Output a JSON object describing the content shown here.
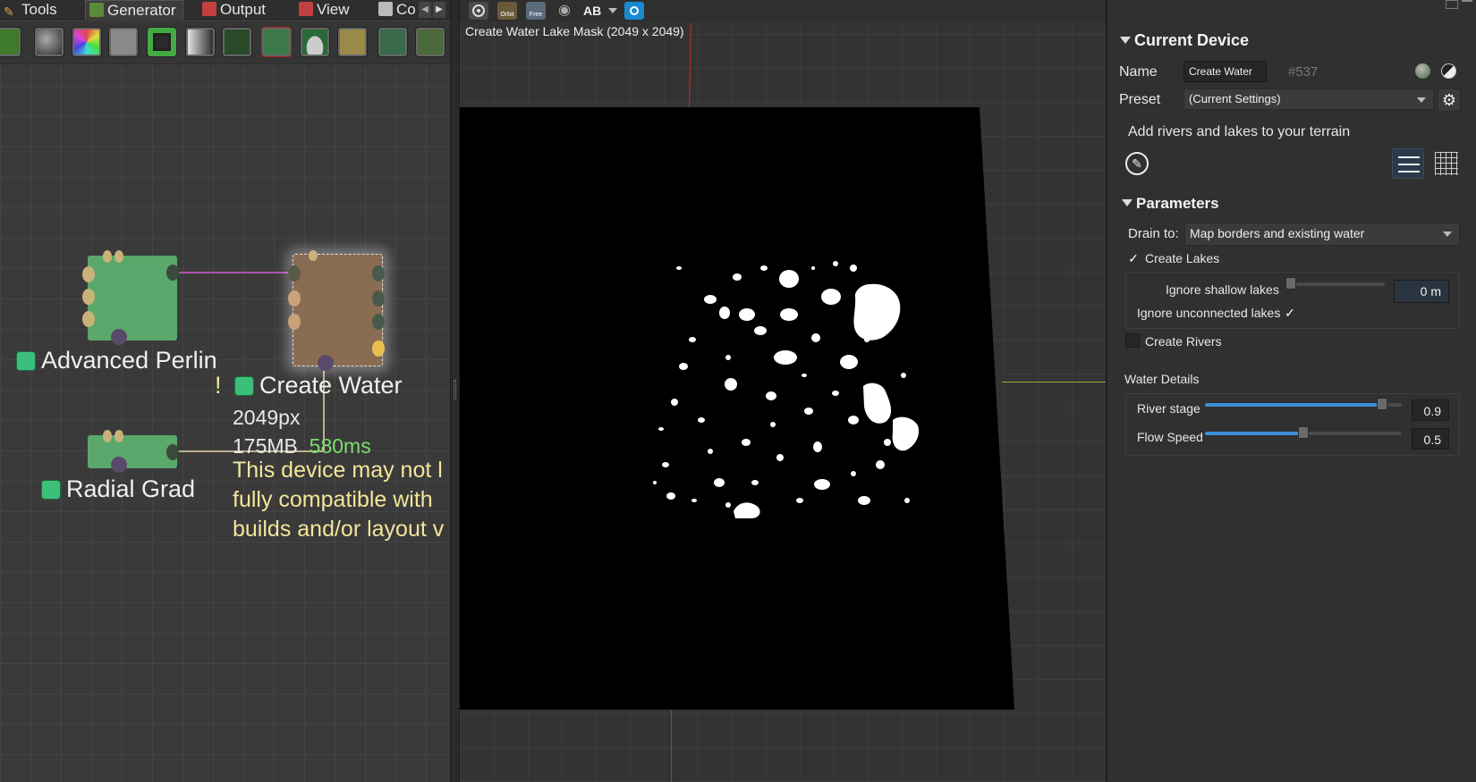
{
  "tabs": [
    {
      "label": "Tools",
      "icon": "tools-icon"
    },
    {
      "label": "Generator",
      "icon": "generator-icon"
    },
    {
      "label": "Output",
      "icon": "output-icon"
    },
    {
      "label": "View",
      "icon": "view-icon"
    },
    {
      "label": "Co",
      "icon": "coverage-icon"
    }
  ],
  "toolbar_icons": [
    "terrain-icon",
    "sphere-icon",
    "color-icon",
    "gray-icon",
    "save-icon",
    "gradient-icon",
    "dots-icon",
    "green-square-icon",
    "hill-icon",
    "map-icon",
    "tiles-icon",
    "noise-icon"
  ],
  "graph": {
    "nodes": {
      "perlin": {
        "label": "Advanced Perlin"
      },
      "water": {
        "label": "Create Water",
        "warning_mark": "!",
        "resolution": "2049px",
        "memory": "175MB",
        "time": "580ms",
        "warning_lines": [
          "This device may not l",
          "fully compatible with",
          "builds and/or layout v"
        ]
      },
      "radial": {
        "label": "Radial Grad"
      }
    },
    "colors": {
      "node_green": "#5aa86b",
      "node_brown": "#8a6c52",
      "link_pink": "#d45ad4",
      "link_cream": "#e8d8a8",
      "time_green": "#7ddc6c",
      "warning_yellow": "#f3e59a"
    }
  },
  "viewport": {
    "title": "Create Water Lake Mask (2049 x 2049)",
    "toolbar_icons": [
      "settings-icon",
      "orbit-icon",
      "free-icon",
      "eye-icon",
      "ab-compare-icon",
      "camera-icon"
    ],
    "ab_label": "AB",
    "orbit_label": "Orbit",
    "free_label": "Free"
  },
  "inspector": {
    "current_device": {
      "header": "Current Device",
      "name_label": "Name",
      "name_value": "Create Water",
      "id": "#537",
      "preset_label": "Preset",
      "preset_value": "(Current Settings)",
      "description": "Add rivers and lakes to your terrain"
    },
    "parameters": {
      "header": "Parameters",
      "drain_label": "Drain to:",
      "drain_value": "Map borders and existing water",
      "create_lakes_label": "Create Lakes",
      "create_lakes_checked": true,
      "ignore_shallow_label": "Ignore shallow lakes",
      "ignore_shallow_value": "0 m",
      "ignore_unconnected_label": "Ignore unconnected lakes",
      "ignore_unconnected_checked": true,
      "create_rivers_label": "Create Rivers",
      "create_rivers_checked": false
    },
    "water_details": {
      "header": "Water Details",
      "river_stage_label": "River stage",
      "river_stage_value": "0.9",
      "river_stage_fraction": 0.9,
      "flow_speed_label": "Flow Speed",
      "flow_speed_value": "0.5",
      "flow_speed_fraction": 0.5
    },
    "check_glyph": "✓"
  }
}
